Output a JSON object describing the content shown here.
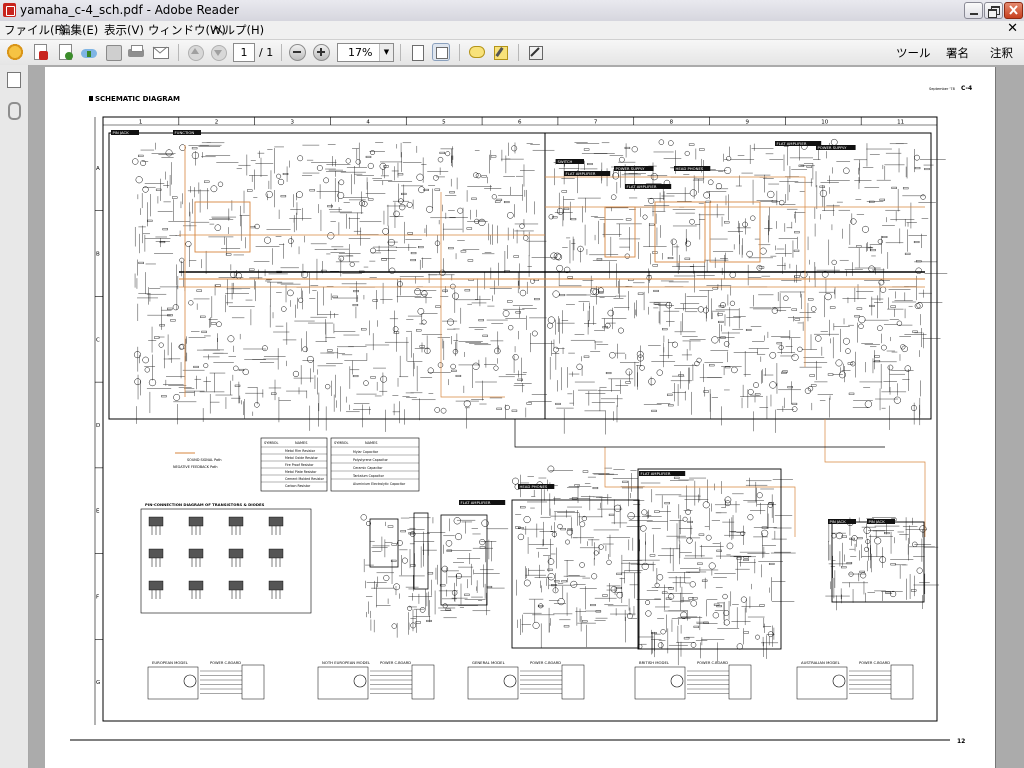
{
  "window": {
    "title": "yamaha_c-4_sch.pdf - Adobe Reader"
  },
  "menu": [
    {
      "label": "ファイル(F)"
    },
    {
      "label": "編集(E)"
    },
    {
      "label": "表示(V)"
    },
    {
      "label": "ウィンドウ(W)"
    },
    {
      "label": "ヘルプ(H)"
    }
  ],
  "toolbar": {
    "page_current": "1",
    "page_total": "/ 1",
    "zoom": "17%",
    "right_tools": [
      "ツール",
      "署名",
      "注釈"
    ]
  },
  "document": {
    "heading": "SCHEMATIC DIAGRAM",
    "header_right": "September '78",
    "model": "C-4",
    "page_number": "12",
    "columns": [
      "1",
      "2",
      "3",
      "4",
      "5",
      "6",
      "7",
      "8",
      "9",
      "10",
      "11"
    ],
    "rows": [
      "A",
      "B",
      "C",
      "D",
      "E",
      "F",
      "G"
    ],
    "blocks": [
      "PIN JACK",
      "FUNCTION",
      "SWITCH",
      "POWER SUPPLY",
      "HEAD PHONES",
      "FLAT AMPLIFIER",
      "FLAT AMPLIFIER",
      "FLAT AMPLIFIER",
      "POWER SUPPLY",
      "FLAT AMPLIFIER",
      "HEAD PHONES",
      "FLAT AMPLIFIER",
      "PIN JACK",
      "PIN JACK"
    ],
    "legend_title": "SYMBOL",
    "legend_col": "NAMES",
    "legend_rows": [
      "Metal Film Resistor",
      "Metal Oxide Resistor",
      "Fire Proof Resistor",
      "Metal Plate Resistor",
      "Cement Molded Resistor",
      "Carbon Resistor"
    ],
    "legend2_rows": [
      "Mylar Capacitor",
      "Polystyrene Capacitor",
      "Ceramic Capacitor",
      "Tantalum Capacitor",
      "Aluminium Electrolytic Capacitor"
    ],
    "signal_legend": [
      "SOUND SIGNAL Path",
      "NEGATIVE FEEDBACK Path"
    ],
    "pin_diagram_title": "PIN-CONNECTION DIAGRAM OF TRANSISTORS & DIODES",
    "models": [
      "EUROPEAN MODEL",
      "NOTH EUROPEAN MODEL",
      "GENERAL MODEL",
      "BRITISH MODEL",
      "AUSTRALIAN MODEL"
    ],
    "board_label": "POWER C.BOARD"
  },
  "colors": {
    "signal_path": "#d7863e",
    "title_red": "#c8231d",
    "wire": "#111111"
  }
}
